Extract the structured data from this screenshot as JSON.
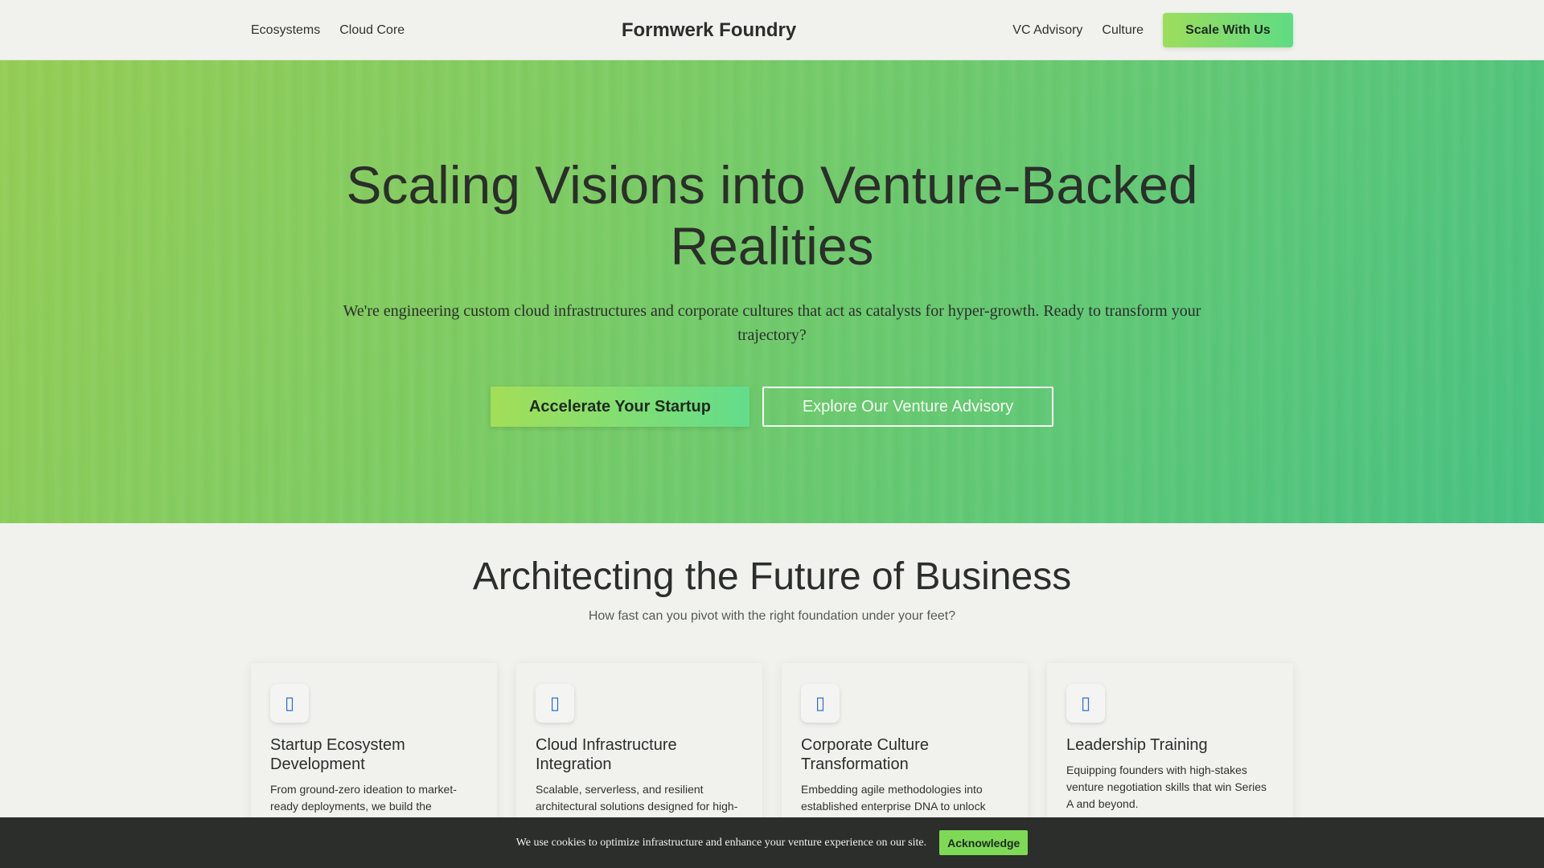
{
  "header": {
    "brand": "Formwerk Foundry",
    "nav_left": [
      "Ecosystems",
      "Cloud Core"
    ],
    "nav_right": [
      "VC Advisory",
      "Culture"
    ],
    "cta": "Scale With Us"
  },
  "hero": {
    "title_line1": "Scaling Visions into Venture-Backed",
    "title_line2": "Realities",
    "subtitle_line1": "We're engineering custom cloud infrastructures and corporate cultures that act as catalysts for hyper-growth. Ready to transform your",
    "subtitle_line2": "trajectory?",
    "primary_button": "Accelerate Your Startup",
    "secondary_button": "Explore Our Venture Advisory"
  },
  "section": {
    "title": "Architecting the Future of Business",
    "subtitle": "How fast can you pivot with the right foundation under your feet?"
  },
  "cards": [
    {
      "icon": "rocket-icon",
      "title_line1": "Startup Ecosystem",
      "title_line2": "Development",
      "text_line1": "From ground-zero ideation to market-",
      "text_line2": "ready deployments, we build the",
      "text_line3": ""
    },
    {
      "icon": "cloud-icon",
      "title_line1": "Cloud Infrastructure",
      "title_line2": "Integration",
      "text_line1": "Scalable, serverless, and resilient",
      "text_line2": "architectural solutions designed for high-",
      "text_line3": ""
    },
    {
      "icon": "users-icon",
      "title_line1": "Corporate Culture",
      "title_line2": "Transformation",
      "text_line1": "Embedding agile methodologies into",
      "text_line2": "established enterprise DNA to unlock",
      "text_line3": ""
    },
    {
      "icon": "chart-icon",
      "title_line1": "Leadership Training",
      "title_line2": "",
      "text_line1": "Equipping founders with high-stakes",
      "text_line2": "venture negotiation skills that win Series",
      "text_line3": "A and beyond."
    }
  ],
  "cookie": {
    "text": "We use cookies to optimize infrastructure and enhance your venture experience on our site.",
    "button": "Acknowledge"
  },
  "colors": {
    "accent_start": "#9ddd5c",
    "accent_end": "#5edc84",
    "icon_color": "#2f6fd6",
    "dark": "#2b2e2a",
    "background": "#f1f2ee"
  }
}
